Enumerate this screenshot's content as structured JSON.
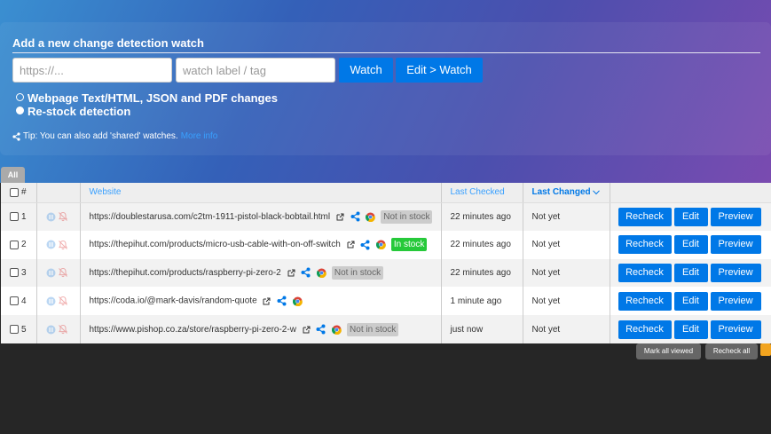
{
  "form": {
    "title": "Add a new change detection watch",
    "url_placeholder": "https://...",
    "tag_placeholder": "watch label / tag",
    "watch_label": "Watch",
    "edit_watch_label": "Edit > Watch",
    "options": [
      {
        "label": "Webpage Text/HTML, JSON and PDF changes",
        "selected": false
      },
      {
        "label": "Re-stock detection",
        "selected": true
      }
    ],
    "tip_text": "Tip: You can also add 'shared' watches.",
    "tip_link": "More info"
  },
  "tabs": {
    "all": "All"
  },
  "table": {
    "headers": {
      "number": "#",
      "website": "Website",
      "last_checked": "Last Checked",
      "last_changed": "Last Changed"
    },
    "rows": [
      {
        "num": "1",
        "url": "https://doublestarusa.com/c2tm-1911-pistol-black-bobtail.html",
        "stock": "Not in stock",
        "stock_state": "out",
        "last_checked": "22 minutes ago",
        "last_changed": "Not yet"
      },
      {
        "num": "2",
        "url": "https://thepihut.com/products/micro-usb-cable-with-on-off-switch",
        "stock": "In stock",
        "stock_state": "in",
        "last_checked": "22 minutes ago",
        "last_changed": "Not yet"
      },
      {
        "num": "3",
        "url": "https://thepihut.com/products/raspberry-pi-zero-2",
        "stock": "Not in stock",
        "stock_state": "out",
        "last_checked": "22 minutes ago",
        "last_changed": "Not yet"
      },
      {
        "num": "4",
        "url": "https://coda.io/@mark-davis/random-quote",
        "stock": "",
        "stock_state": "none",
        "last_checked": "1 minute ago",
        "last_changed": "Not yet"
      },
      {
        "num": "5",
        "url": "https://www.pishop.co.za/store/raspberry-pi-zero-2-w",
        "stock": "Not in stock",
        "stock_state": "out",
        "last_checked": "just now",
        "last_changed": "Not yet"
      }
    ],
    "row_buttons": {
      "recheck": "Recheck",
      "edit": "Edit",
      "preview": "Preview"
    }
  },
  "footer": {
    "mark_all_viewed": "Mark all viewed",
    "recheck_all": "Recheck all"
  },
  "colors": {
    "accent": "#0078e7",
    "in_stock": "#26c93a",
    "rss": "#f2a41f"
  }
}
